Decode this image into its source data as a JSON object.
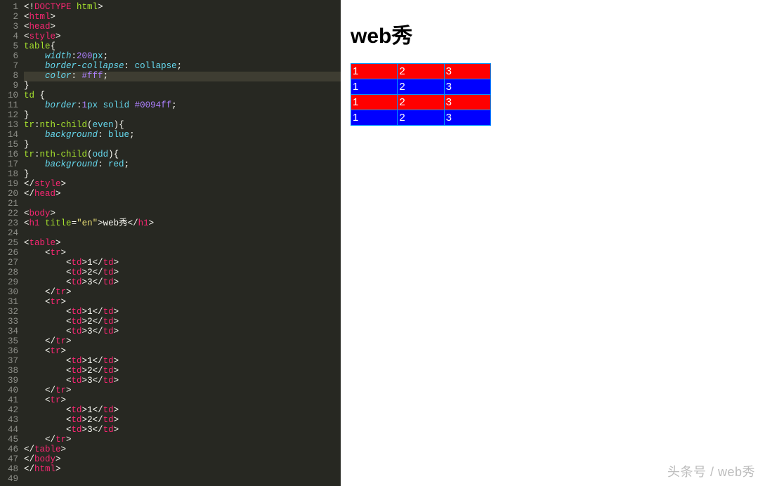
{
  "editor": {
    "lines": [
      {
        "n": "1",
        "seg": [
          [
            "punc",
            "<!"
          ],
          [
            "tag",
            "DOCTYPE"
          ],
          [
            "txt",
            " "
          ],
          [
            "attr",
            "html"
          ],
          [
            "punc",
            ">"
          ]
        ]
      },
      {
        "n": "2",
        "seg": [
          [
            "punc",
            "<"
          ],
          [
            "tag",
            "html"
          ],
          [
            "punc",
            ">"
          ]
        ]
      },
      {
        "n": "3",
        "seg": [
          [
            "punc",
            "<"
          ],
          [
            "tag",
            "head"
          ],
          [
            "punc",
            ">"
          ]
        ]
      },
      {
        "n": "4",
        "seg": [
          [
            "punc",
            "<"
          ],
          [
            "tag",
            "style"
          ],
          [
            "punc",
            ">"
          ]
        ]
      },
      {
        "n": "5",
        "seg": [
          [
            "sel",
            "table"
          ],
          [
            "punc",
            "{"
          ]
        ]
      },
      {
        "n": "6",
        "seg": [
          [
            "txt",
            "    "
          ],
          [
            "prop",
            "width"
          ],
          [
            "punc",
            ":"
          ],
          [
            "num",
            "200"
          ],
          [
            "valw",
            "px"
          ],
          [
            "punc",
            ";"
          ]
        ]
      },
      {
        "n": "7",
        "seg": [
          [
            "txt",
            "    "
          ],
          [
            "prop",
            "border-collapse"
          ],
          [
            "punc",
            ": "
          ],
          [
            "valw",
            "collapse"
          ],
          [
            "punc",
            ";"
          ]
        ]
      },
      {
        "n": "8",
        "hl": true,
        "seg": [
          [
            "txt",
            "    "
          ],
          [
            "prop",
            "color"
          ],
          [
            "punc",
            ": "
          ],
          [
            "val",
            "#fff"
          ],
          [
            "punc",
            ";"
          ]
        ]
      },
      {
        "n": "9",
        "seg": [
          [
            "punc",
            "}"
          ]
        ]
      },
      {
        "n": "10",
        "seg": [
          [
            "sel",
            "td"
          ],
          [
            "txt",
            " "
          ],
          [
            "punc",
            "{"
          ]
        ]
      },
      {
        "n": "11",
        "seg": [
          [
            "txt",
            "    "
          ],
          [
            "prop",
            "border"
          ],
          [
            "punc",
            ":"
          ],
          [
            "num",
            "1"
          ],
          [
            "valw",
            "px"
          ],
          [
            "txt",
            " "
          ],
          [
            "valw",
            "solid"
          ],
          [
            "txt",
            " "
          ],
          [
            "val",
            "#0094ff"
          ],
          [
            "punc",
            ";"
          ]
        ]
      },
      {
        "n": "12",
        "seg": [
          [
            "punc",
            "}"
          ]
        ]
      },
      {
        "n": "13",
        "seg": [
          [
            "sel",
            "tr"
          ],
          [
            "punc",
            ":"
          ],
          [
            "sel",
            "nth-child"
          ],
          [
            "punc",
            "("
          ],
          [
            "valw",
            "even"
          ],
          [
            "punc",
            "){"
          ]
        ]
      },
      {
        "n": "14",
        "seg": [
          [
            "txt",
            "    "
          ],
          [
            "prop",
            "background"
          ],
          [
            "punc",
            ": "
          ],
          [
            "valw",
            "blue"
          ],
          [
            "punc",
            ";"
          ]
        ]
      },
      {
        "n": "15",
        "seg": [
          [
            "punc",
            "}"
          ]
        ]
      },
      {
        "n": "16",
        "seg": [
          [
            "sel",
            "tr"
          ],
          [
            "punc",
            ":"
          ],
          [
            "sel",
            "nth-child"
          ],
          [
            "punc",
            "("
          ],
          [
            "valw",
            "odd"
          ],
          [
            "punc",
            "){"
          ]
        ]
      },
      {
        "n": "17",
        "seg": [
          [
            "txt",
            "    "
          ],
          [
            "prop",
            "background"
          ],
          [
            "punc",
            ": "
          ],
          [
            "valw",
            "red"
          ],
          [
            "punc",
            ";"
          ]
        ]
      },
      {
        "n": "18",
        "seg": [
          [
            "punc",
            "}"
          ]
        ]
      },
      {
        "n": "19",
        "seg": [
          [
            "punc",
            "</"
          ],
          [
            "tag",
            "style"
          ],
          [
            "punc",
            ">"
          ]
        ]
      },
      {
        "n": "20",
        "seg": [
          [
            "punc",
            "</"
          ],
          [
            "tag",
            "head"
          ],
          [
            "punc",
            ">"
          ]
        ]
      },
      {
        "n": "21",
        "seg": []
      },
      {
        "n": "22",
        "seg": [
          [
            "punc",
            "<"
          ],
          [
            "tag",
            "body"
          ],
          [
            "punc",
            ">"
          ]
        ]
      },
      {
        "n": "23",
        "seg": [
          [
            "punc",
            "<"
          ],
          [
            "tag",
            "h1"
          ],
          [
            "txt",
            " "
          ],
          [
            "attr",
            "title"
          ],
          [
            "punc",
            "="
          ],
          [
            "str",
            "\"en\""
          ],
          [
            "punc",
            ">"
          ],
          [
            "txt",
            "web秀"
          ],
          [
            "punc",
            "</"
          ],
          [
            "tag",
            "h1"
          ],
          [
            "punc",
            ">"
          ]
        ]
      },
      {
        "n": "24",
        "seg": []
      },
      {
        "n": "25",
        "seg": [
          [
            "punc",
            "<"
          ],
          [
            "tag",
            "table"
          ],
          [
            "punc",
            ">"
          ]
        ]
      },
      {
        "n": "26",
        "seg": [
          [
            "txt",
            "    "
          ],
          [
            "punc",
            "<"
          ],
          [
            "tag",
            "tr"
          ],
          [
            "punc",
            ">"
          ]
        ]
      },
      {
        "n": "27",
        "seg": [
          [
            "txt",
            "        "
          ],
          [
            "punc",
            "<"
          ],
          [
            "tag",
            "td"
          ],
          [
            "punc",
            ">"
          ],
          [
            "txt",
            "1"
          ],
          [
            "punc",
            "</"
          ],
          [
            "tag",
            "td"
          ],
          [
            "punc",
            ">"
          ]
        ]
      },
      {
        "n": "28",
        "seg": [
          [
            "txt",
            "        "
          ],
          [
            "punc",
            "<"
          ],
          [
            "tag",
            "td"
          ],
          [
            "punc",
            ">"
          ],
          [
            "txt",
            "2"
          ],
          [
            "punc",
            "</"
          ],
          [
            "tag",
            "td"
          ],
          [
            "punc",
            ">"
          ]
        ]
      },
      {
        "n": "29",
        "seg": [
          [
            "txt",
            "        "
          ],
          [
            "punc",
            "<"
          ],
          [
            "tag",
            "td"
          ],
          [
            "punc",
            ">"
          ],
          [
            "txt",
            "3"
          ],
          [
            "punc",
            "</"
          ],
          [
            "tag",
            "td"
          ],
          [
            "punc",
            ">"
          ]
        ]
      },
      {
        "n": "30",
        "seg": [
          [
            "txt",
            "    "
          ],
          [
            "punc",
            "</"
          ],
          [
            "tag",
            "tr"
          ],
          [
            "punc",
            ">"
          ]
        ]
      },
      {
        "n": "31",
        "seg": [
          [
            "txt",
            "    "
          ],
          [
            "punc",
            "<"
          ],
          [
            "tag",
            "tr"
          ],
          [
            "punc",
            ">"
          ]
        ]
      },
      {
        "n": "32",
        "seg": [
          [
            "txt",
            "        "
          ],
          [
            "punc",
            "<"
          ],
          [
            "tag",
            "td"
          ],
          [
            "punc",
            ">"
          ],
          [
            "txt",
            "1"
          ],
          [
            "punc",
            "</"
          ],
          [
            "tag",
            "td"
          ],
          [
            "punc",
            ">"
          ]
        ]
      },
      {
        "n": "33",
        "seg": [
          [
            "txt",
            "        "
          ],
          [
            "punc",
            "<"
          ],
          [
            "tag",
            "td"
          ],
          [
            "punc",
            ">"
          ],
          [
            "txt",
            "2"
          ],
          [
            "punc",
            "</"
          ],
          [
            "tag",
            "td"
          ],
          [
            "punc",
            ">"
          ]
        ]
      },
      {
        "n": "34",
        "seg": [
          [
            "txt",
            "        "
          ],
          [
            "punc",
            "<"
          ],
          [
            "tag",
            "td"
          ],
          [
            "punc",
            ">"
          ],
          [
            "txt",
            "3"
          ],
          [
            "punc",
            "</"
          ],
          [
            "tag",
            "td"
          ],
          [
            "punc",
            ">"
          ]
        ]
      },
      {
        "n": "35",
        "seg": [
          [
            "txt",
            "    "
          ],
          [
            "punc",
            "</"
          ],
          [
            "tag",
            "tr"
          ],
          [
            "punc",
            ">"
          ]
        ]
      },
      {
        "n": "36",
        "seg": [
          [
            "txt",
            "    "
          ],
          [
            "punc",
            "<"
          ],
          [
            "tag",
            "tr"
          ],
          [
            "punc",
            ">"
          ]
        ]
      },
      {
        "n": "37",
        "seg": [
          [
            "txt",
            "        "
          ],
          [
            "punc",
            "<"
          ],
          [
            "tag",
            "td"
          ],
          [
            "punc",
            ">"
          ],
          [
            "txt",
            "1"
          ],
          [
            "punc",
            "</"
          ],
          [
            "tag",
            "td"
          ],
          [
            "punc",
            ">"
          ]
        ]
      },
      {
        "n": "38",
        "seg": [
          [
            "txt",
            "        "
          ],
          [
            "punc",
            "<"
          ],
          [
            "tag",
            "td"
          ],
          [
            "punc",
            ">"
          ],
          [
            "txt",
            "2"
          ],
          [
            "punc",
            "</"
          ],
          [
            "tag",
            "td"
          ],
          [
            "punc",
            ">"
          ]
        ]
      },
      {
        "n": "39",
        "seg": [
          [
            "txt",
            "        "
          ],
          [
            "punc",
            "<"
          ],
          [
            "tag",
            "td"
          ],
          [
            "punc",
            ">"
          ],
          [
            "txt",
            "3"
          ],
          [
            "punc",
            "</"
          ],
          [
            "tag",
            "td"
          ],
          [
            "punc",
            ">"
          ]
        ]
      },
      {
        "n": "40",
        "seg": [
          [
            "txt",
            "    "
          ],
          [
            "punc",
            "</"
          ],
          [
            "tag",
            "tr"
          ],
          [
            "punc",
            ">"
          ]
        ]
      },
      {
        "n": "41",
        "seg": [
          [
            "txt",
            "    "
          ],
          [
            "punc",
            "<"
          ],
          [
            "tag",
            "tr"
          ],
          [
            "punc",
            ">"
          ]
        ]
      },
      {
        "n": "42",
        "seg": [
          [
            "txt",
            "        "
          ],
          [
            "punc",
            "<"
          ],
          [
            "tag",
            "td"
          ],
          [
            "punc",
            ">"
          ],
          [
            "txt",
            "1"
          ],
          [
            "punc",
            "</"
          ],
          [
            "tag",
            "td"
          ],
          [
            "punc",
            ">"
          ]
        ]
      },
      {
        "n": "43",
        "seg": [
          [
            "txt",
            "        "
          ],
          [
            "punc",
            "<"
          ],
          [
            "tag",
            "td"
          ],
          [
            "punc",
            ">"
          ],
          [
            "txt",
            "2"
          ],
          [
            "punc",
            "</"
          ],
          [
            "tag",
            "td"
          ],
          [
            "punc",
            ">"
          ]
        ]
      },
      {
        "n": "44",
        "seg": [
          [
            "txt",
            "        "
          ],
          [
            "punc",
            "<"
          ],
          [
            "tag",
            "td"
          ],
          [
            "punc",
            ">"
          ],
          [
            "txt",
            "3"
          ],
          [
            "punc",
            "</"
          ],
          [
            "tag",
            "td"
          ],
          [
            "punc",
            ">"
          ]
        ]
      },
      {
        "n": "45",
        "seg": [
          [
            "txt",
            "    "
          ],
          [
            "punc",
            "</"
          ],
          [
            "tag",
            "tr"
          ],
          [
            "punc",
            ">"
          ]
        ]
      },
      {
        "n": "46",
        "seg": [
          [
            "punc",
            "</"
          ],
          [
            "tag",
            "table"
          ],
          [
            "punc",
            ">"
          ]
        ]
      },
      {
        "n": "47",
        "seg": [
          [
            "punc",
            "</"
          ],
          [
            "tag",
            "body"
          ],
          [
            "punc",
            ">"
          ]
        ]
      },
      {
        "n": "48",
        "seg": [
          [
            "punc",
            "</"
          ],
          [
            "tag",
            "html"
          ],
          [
            "punc",
            ">"
          ]
        ]
      },
      {
        "n": "49",
        "seg": []
      }
    ]
  },
  "preview": {
    "heading": "web秀",
    "table": {
      "rows": [
        [
          "1",
          "2",
          "3"
        ],
        [
          "1",
          "2",
          "3"
        ],
        [
          "1",
          "2",
          "3"
        ],
        [
          "1",
          "2",
          "3"
        ]
      ]
    }
  },
  "watermark": "头条号 / web秀"
}
